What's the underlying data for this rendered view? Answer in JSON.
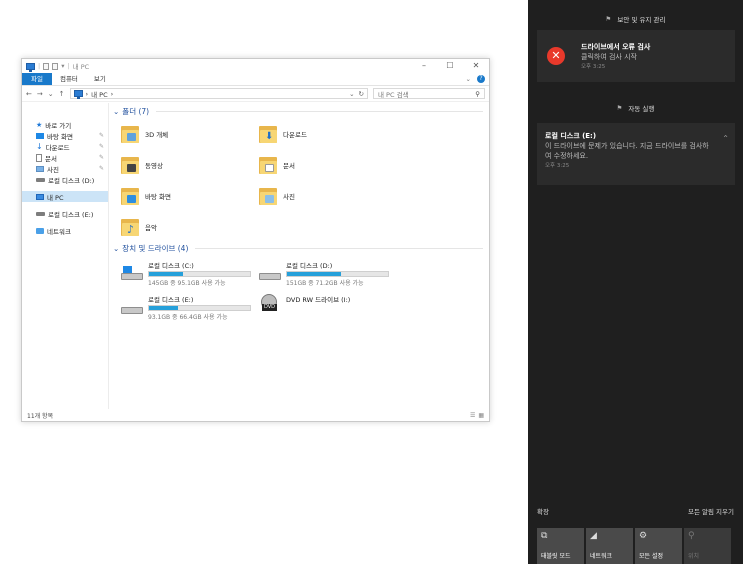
{
  "explorer": {
    "title": "내 PC",
    "ribbon": {
      "file": "파일",
      "tabs": [
        "컴퓨터",
        "보기"
      ]
    },
    "address": {
      "path": "내 PC",
      "search_placeholder": "내 PC 검색"
    },
    "nav": [
      {
        "label": "바로 가기",
        "icon": "star-icon",
        "pinned": false
      },
      {
        "label": "바탕 화면",
        "icon": "desktop-icon",
        "pinned": true
      },
      {
        "label": "다운로드",
        "icon": "download-icon",
        "pinned": true
      },
      {
        "label": "문서",
        "icon": "document-icon",
        "pinned": true
      },
      {
        "label": "사진",
        "icon": "pictures-icon",
        "pinned": true
      },
      {
        "label": "로컬 디스크 (D:)",
        "icon": "drive-icon",
        "pinned": false
      },
      {
        "label": "내 PC",
        "icon": "pc-icon",
        "selected": true
      },
      {
        "label": "로컬 디스크 (E:)",
        "icon": "drive-icon"
      },
      {
        "label": "네트워크",
        "icon": "network-icon"
      }
    ],
    "folders_header": "폴더 (7)",
    "folders": [
      "3D 개체",
      "다운로드",
      "동영상",
      "문서",
      "바탕 화면",
      "사진",
      "음악"
    ],
    "drives_header": "장치 및 드라이브 (4)",
    "drives": [
      {
        "name": "로컬 디스크 (C:)",
        "info": "145GB 중 95.1GB 사용 가능",
        "used_fraction": 0.34
      },
      {
        "name": "로컬 디스크 (D:)",
        "info": "151GB 중 71.2GB 사용 가능",
        "used_fraction": 0.53
      },
      {
        "name": "로컬 디스크 (E:)",
        "info": "93.1GB 중 66.4GB 사용 가능",
        "used_fraction": 0.29
      },
      {
        "name": "DVD RW 드라이브 (I:)",
        "info": ""
      }
    ],
    "status": "11개 항목"
  },
  "action_center": {
    "section1": "보안 및 유지 관리",
    "notif1": {
      "title": "드라이브에서 오류 검사",
      "body": "클릭하여 검사 시작",
      "time": "오후 3:25"
    },
    "section2": "자동 실행",
    "notif2": {
      "title": "로컬 디스크 (E:)",
      "body": "이 드라이브에 문제가 있습니다. 지금 드라이브를 검사하여 수정하세요.",
      "time": "오후 3:25"
    },
    "expand": "확장",
    "clear_all": "모든 알림 지우기",
    "tiles": [
      {
        "label": "태블릿 모드",
        "icon": "tablet-icon",
        "active": true
      },
      {
        "label": "네트워크",
        "icon": "network-icon",
        "active": true
      },
      {
        "label": "모든 설정",
        "icon": "settings-icon",
        "active": true
      },
      {
        "label": "위치",
        "icon": "location-icon",
        "active": false
      }
    ]
  },
  "colors": {
    "accent": "#1979ca",
    "error": "#e8392b",
    "progress": "#26a0da",
    "panel": "#1f1f1f"
  }
}
